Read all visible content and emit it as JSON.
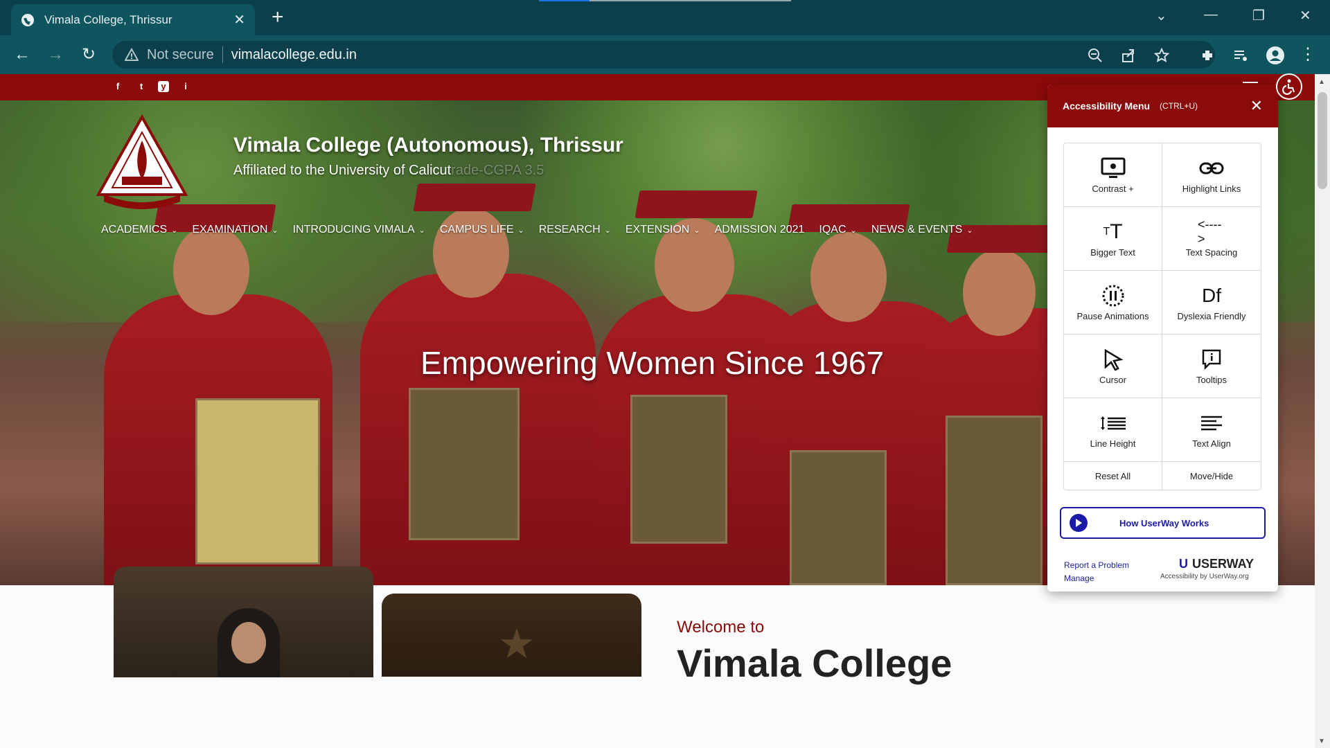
{
  "browser": {
    "tab_title": "Vimala College, Thrissur",
    "security_label": "Not secure",
    "url": "vimalacollege.edu.in",
    "load_progress": 0.2
  },
  "site": {
    "title": "Vimala College (Autonomous), Thrissur",
    "subtitle": "Affiliated to the University of Calicut",
    "subtitle_overlap": "rade-CGPA 3.5",
    "tagline": "Empowering Women Since 1967",
    "menu": [
      {
        "label": "ACADEMICS"
      },
      {
        "label": "EXAMINATION"
      },
      {
        "label": "INTRODUCING VIMALA"
      },
      {
        "label": "CAMPUS LIFE"
      },
      {
        "label": "RESEARCH"
      },
      {
        "label": "EXTENSION"
      },
      {
        "label": "ADMISSION 2021"
      },
      {
        "label": "IQAC"
      },
      {
        "label": "NEWS & EVENTS"
      }
    ],
    "social": [
      "f",
      "t",
      "y",
      "i"
    ],
    "welcome": "Welcome to",
    "name_heading": "Vimala College",
    "accent_color": "#8b0a0a"
  },
  "accessibility": {
    "title": "Accessibility Menu",
    "shortcut": "(CTRL+U)",
    "options": [
      {
        "label": "Contrast +",
        "icon": "monitor-icon"
      },
      {
        "label": "Highlight Links",
        "icon": "link-icon"
      },
      {
        "label": "Bigger Text",
        "icon": "text-size-icon"
      },
      {
        "label": "Text Spacing",
        "icon": "spacing-icon"
      },
      {
        "label": "Pause Animations",
        "icon": "pause-icon"
      },
      {
        "label": "Dyslexia Friendly",
        "icon": "dyslexia-icon"
      },
      {
        "label": "Cursor",
        "icon": "cursor-icon"
      },
      {
        "label": "Tooltips",
        "icon": "tooltip-icon"
      },
      {
        "label": "Line Height",
        "icon": "line-height-icon"
      },
      {
        "label": "Text Align",
        "icon": "text-align-icon"
      }
    ],
    "reset_label": "Reset All",
    "move_label": "Move/Hide",
    "how_label": "How UserWay Works",
    "report_label": "Report a Problem",
    "manage_label": "Manage",
    "brand": "USERWAY",
    "brand_sub": "Accessibility by UserWay.org"
  }
}
